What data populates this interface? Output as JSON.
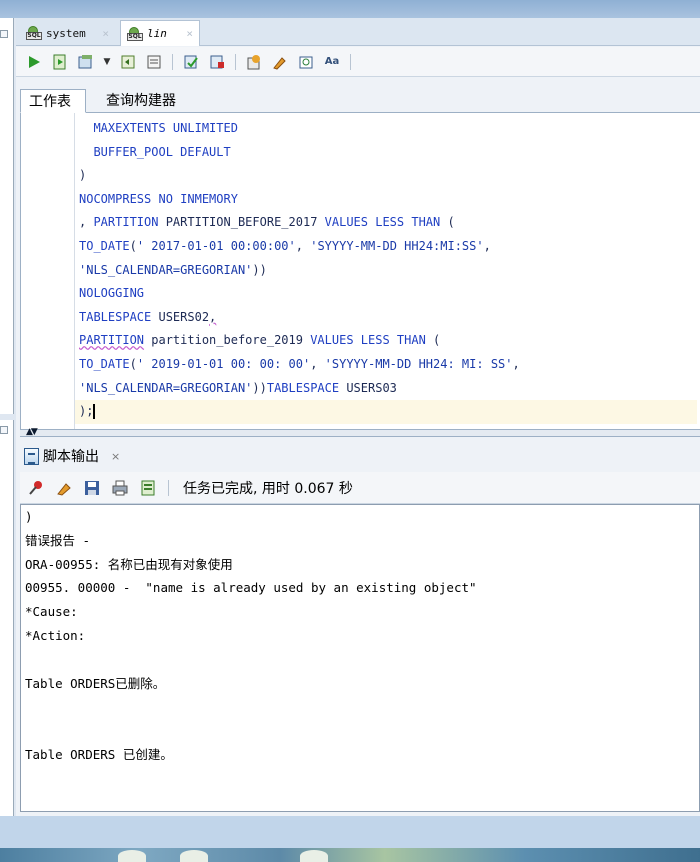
{
  "doc_tabs": [
    {
      "label": "system",
      "icon_text": "SQL"
    },
    {
      "label": "lin",
      "icon_text": "SQL"
    }
  ],
  "toolbar_icons": [
    "run-icon",
    "run-script-icon",
    "commit-icon",
    "dropdown-icon",
    "rollback-icon",
    "explain-plan-icon",
    "autotrace-icon",
    "sql-tuning-icon",
    "clear-icon",
    "format-icon",
    "sql-history-icon",
    "spell-check-icon"
  ],
  "subtabs": {
    "worksheet": "工作表",
    "query_builder": "查询构建器"
  },
  "editor": {
    "lines": [
      [
        {
          "t": "  "
        },
        {
          "t": "MAXEXTENTS UNLIMITED",
          "c": "kw"
        }
      ],
      [
        {
          "t": "  "
        },
        {
          "t": "BUFFER_POOL DEFAULT",
          "c": "kw"
        }
      ],
      [
        {
          "t": ")",
          "c": "pl"
        }
      ],
      [
        {
          "t": "NOCOMPRESS NO INMEMORY",
          "c": "kw"
        }
      ],
      [
        {
          "t": ", ",
          "c": "pl"
        },
        {
          "t": "PARTITION",
          "c": "kw"
        },
        {
          "t": " PARTITION_BEFORE_2017 ",
          "c": "pl"
        },
        {
          "t": "VALUES LESS THAN",
          "c": "kw"
        },
        {
          "t": " (",
          "c": "pl"
        }
      ],
      [
        {
          "t": "TO_DATE",
          "c": "kw"
        },
        {
          "t": "(",
          "c": "pl"
        },
        {
          "t": "' 2017-01-01 00:00:00'",
          "c": "str"
        },
        {
          "t": ", ",
          "c": "pl"
        },
        {
          "t": "'SYYYY-MM-DD HH24:MI:SS'",
          "c": "str"
        },
        {
          "t": ",",
          "c": "pl"
        }
      ],
      [
        {
          "t": "'NLS_CALENDAR=GREGORIAN'",
          "c": "str"
        },
        {
          "t": "))",
          "c": "pl"
        }
      ],
      [
        {
          "t": "NOLOGGING",
          "c": "kw"
        }
      ],
      [
        {
          "t": "TABLESPACE",
          "c": "kw"
        },
        {
          "t": " USERS02",
          "c": "pl"
        },
        {
          "t": ",",
          "c": "pl squig"
        }
      ],
      [
        {
          "t": "PARTITION",
          "c": "kw squig"
        },
        {
          "t": " partition_before_2019 ",
          "c": "pl"
        },
        {
          "t": "VALUES LESS THAN",
          "c": "kw"
        },
        {
          "t": " (",
          "c": "pl"
        }
      ],
      [
        {
          "t": "TO_DATE",
          "c": "kw"
        },
        {
          "t": "(",
          "c": "pl"
        },
        {
          "t": "' 2019-01-01 00: 00: 00'",
          "c": "str"
        },
        {
          "t": ", ",
          "c": "pl"
        },
        {
          "t": "'SYYYY-MM-DD HH24: MI: SS'",
          "c": "str"
        },
        {
          "t": ",",
          "c": "pl"
        }
      ],
      [
        {
          "t": "'NLS_CALENDAR=GREGORIAN'",
          "c": "str"
        },
        {
          "t": "))",
          "c": "pl"
        },
        {
          "t": "TABLESPACE",
          "c": "kw"
        },
        {
          "t": " USERS03",
          "c": "pl"
        }
      ],
      [
        {
          "t": ");",
          "c": "pl"
        }
      ]
    ],
    "current_line": 12
  },
  "output_panel": {
    "tab_label": "脚本输出",
    "status": "任务已完成, 用时 0.067 秒",
    "toolbar_icons": [
      "pin-icon",
      "eraser-icon",
      "save-icon",
      "print-icon",
      "open-icon"
    ],
    "lines": [
      ")",
      "错误报告 -",
      "ORA-00955: 名称已由现有对象使用",
      "00955. 00000 -  \"name is already used by an existing object\"",
      "*Cause:",
      "*Action:",
      "",
      "Table ORDERS已删除。",
      "",
      "",
      "Table ORDERS 已创建。"
    ]
  },
  "colors": {
    "keyword": "#1f3fc2",
    "string": "#1a3aa8",
    "current_line": "#fdf8e4",
    "frame": "#c5d7ea"
  }
}
